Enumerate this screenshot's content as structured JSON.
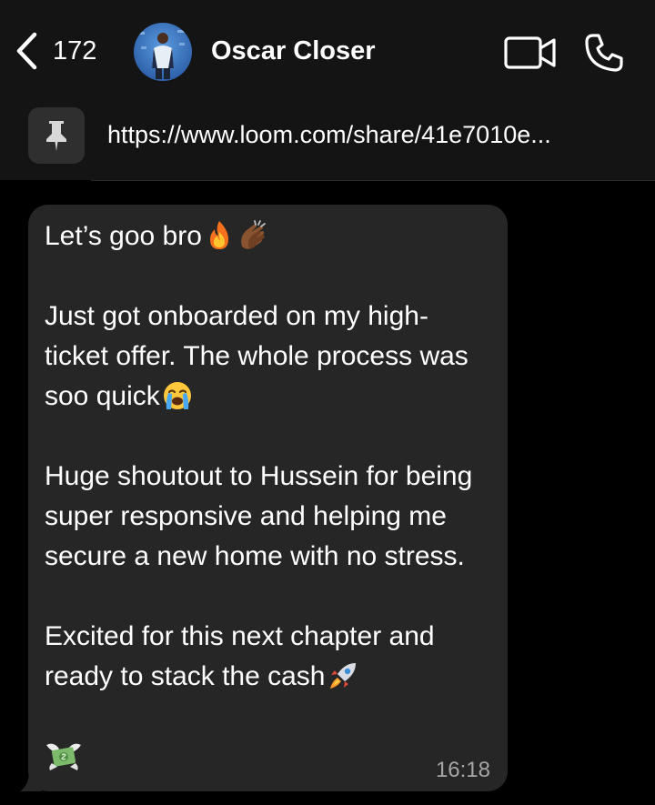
{
  "header": {
    "back_count": "172",
    "contact_name": "Oscar Closer",
    "icons": {
      "back": "chevron-left-icon",
      "video": "video-camera-icon",
      "call": "phone-icon"
    }
  },
  "pinned": {
    "icon": "pin-icon",
    "text": "https://www.loom.com/share/41e7010e..."
  },
  "message": {
    "line1": "Let’s goo bro",
    "para1": "Just got onboarded on my high-ticket offer. The whole process was soo quick",
    "para2": "Huge shoutout to Hussein for being super responsive and helping me secure a new home with no stress.",
    "para3": "Excited for this next chapter and ready to stack the cash",
    "emojis": [
      "fire",
      "clapping-hands",
      "loudly-crying-face",
      "rocket",
      "money-with-wings"
    ],
    "time": "16:18"
  },
  "colors": {
    "background": "#000000",
    "header": "#141414",
    "bubble": "#262626",
    "pin_badge": "#2f2f2f",
    "timestamp": "#a6a6a6"
  }
}
